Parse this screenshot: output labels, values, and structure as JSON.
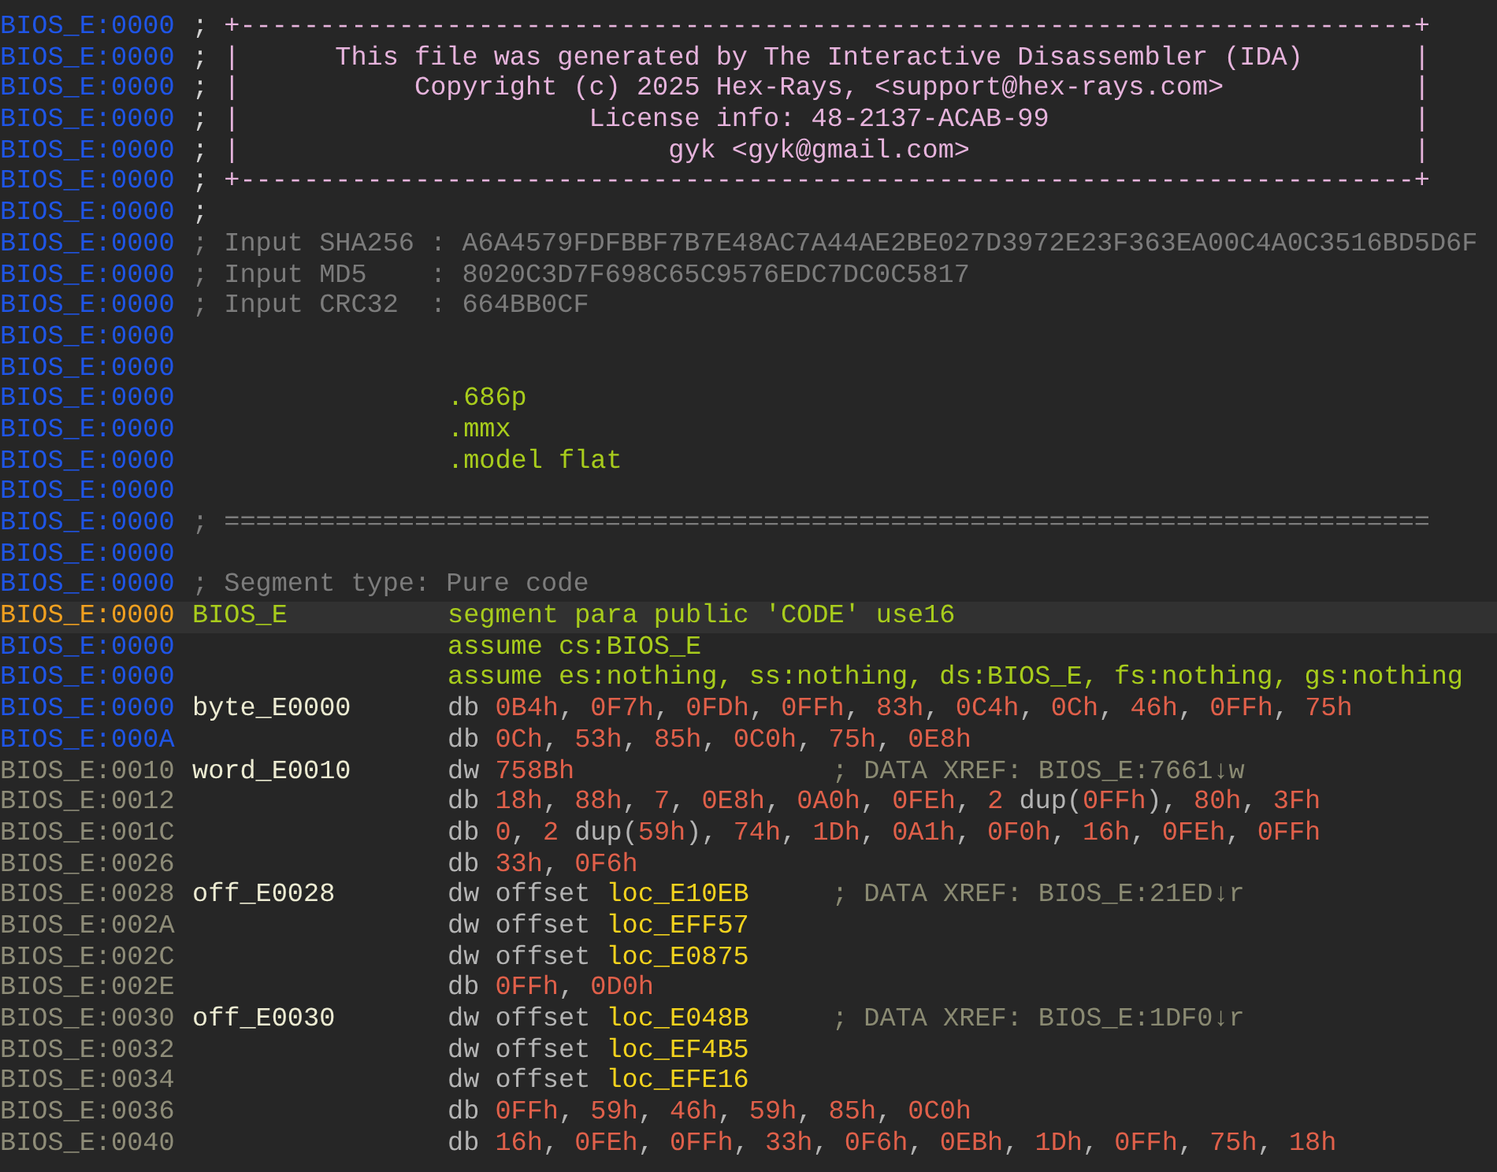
{
  "listing": {
    "lines": [
      {
        "address": "BIOS_E:0000",
        "kind": "code",
        "selected": false,
        "comment": [
          {
            "text": "; ",
            "kind": "punct"
          },
          {
            "text": "+--------------------------------------------------------------------------+",
            "kind": "banner"
          }
        ]
      },
      {
        "address": "BIOS_E:0000",
        "kind": "code",
        "selected": false,
        "comment": [
          {
            "text": "; ",
            "kind": "punct"
          },
          {
            "text": "|      This file was generated by The Interactive Disassembler (IDA)       |",
            "kind": "banner"
          }
        ]
      },
      {
        "address": "BIOS_E:0000",
        "kind": "code",
        "selected": false,
        "comment": [
          {
            "text": "; ",
            "kind": "punct"
          },
          {
            "text": "|           Copyright (c) 2025 Hex-Rays, <support@hex-rays.com>            |",
            "kind": "banner"
          }
        ]
      },
      {
        "address": "BIOS_E:0000",
        "kind": "code",
        "selected": false,
        "comment": [
          {
            "text": "; ",
            "kind": "punct"
          },
          {
            "text": "|                      License info: 48-2137-ACAB-99                       |",
            "kind": "banner"
          }
        ]
      },
      {
        "address": "BIOS_E:0000",
        "kind": "code",
        "selected": false,
        "comment": [
          {
            "text": "; ",
            "kind": "punct"
          },
          {
            "text": "|                           gyk <gyk@gmail.com>                            |",
            "kind": "banner"
          }
        ]
      },
      {
        "address": "BIOS_E:0000",
        "kind": "code",
        "selected": false,
        "comment": [
          {
            "text": "; ",
            "kind": "punct"
          },
          {
            "text": "+--------------------------------------------------------------------------+",
            "kind": "banner"
          }
        ]
      },
      {
        "address": "BIOS_E:0000",
        "kind": "code",
        "selected": false,
        "comment": [
          {
            "text": ";",
            "kind": "punct"
          }
        ]
      },
      {
        "address": "BIOS_E:0000",
        "kind": "code",
        "selected": false,
        "comment": [
          {
            "text": "; Input SHA256 : A6A4579FDFBBF7B7E48AC7A44AE2BE027D3972E23F363EA00C4A0C3516BD5D6F",
            "kind": "note"
          }
        ]
      },
      {
        "address": "BIOS_E:0000",
        "kind": "code",
        "selected": false,
        "comment": [
          {
            "text": "; Input MD5    : 8020C3D7F698C65C9576EDC7DC0C5817",
            "kind": "note"
          }
        ]
      },
      {
        "address": "BIOS_E:0000",
        "kind": "code",
        "selected": false,
        "comment": [
          {
            "text": "; Input CRC32  : 664BB0CF",
            "kind": "note"
          }
        ]
      },
      {
        "address": "BIOS_E:0000",
        "kind": "code",
        "selected": false
      },
      {
        "address": "BIOS_E:0000",
        "kind": "code",
        "selected": false
      },
      {
        "address": "BIOS_E:0000",
        "kind": "code",
        "selected": false,
        "code": [
          {
            "text": ".686p",
            "kind": "directive"
          }
        ]
      },
      {
        "address": "BIOS_E:0000",
        "kind": "code",
        "selected": false,
        "code": [
          {
            "text": ".mmx",
            "kind": "directive"
          }
        ]
      },
      {
        "address": "BIOS_E:0000",
        "kind": "code",
        "selected": false,
        "code": [
          {
            "text": ".model flat",
            "kind": "directive"
          }
        ]
      },
      {
        "address": "BIOS_E:0000",
        "kind": "code",
        "selected": false
      },
      {
        "address": "BIOS_E:0000",
        "kind": "code",
        "selected": false,
        "comment": [
          {
            "text": "; ============================================================================",
            "kind": "note"
          }
        ]
      },
      {
        "address": "BIOS_E:0000",
        "kind": "code",
        "selected": false
      },
      {
        "address": "BIOS_E:0000",
        "kind": "code",
        "selected": false,
        "comment": [
          {
            "text": "; Segment type: Pure code",
            "kind": "note"
          }
        ]
      },
      {
        "address": "BIOS_E:0000",
        "kind": "code",
        "selected": true,
        "label": {
          "text": "BIOS_E",
          "kind": "segment"
        },
        "code": [
          {
            "text": "segment para public 'CODE' use16",
            "kind": "directive"
          }
        ]
      },
      {
        "address": "BIOS_E:0000",
        "kind": "code",
        "selected": false,
        "code": [
          {
            "text": "assume cs:BIOS_E",
            "kind": "directive"
          }
        ]
      },
      {
        "address": "BIOS_E:0000",
        "kind": "code",
        "selected": false,
        "code": [
          {
            "text": "assume es:nothing, ss:nothing, ds:BIOS_E, fs:nothing, gs:nothing",
            "kind": "directive"
          }
        ]
      },
      {
        "address": "BIOS_E:0000",
        "kind": "code",
        "selected": false,
        "label": {
          "text": "byte_E0000",
          "kind": "name"
        },
        "code": [
          {
            "text": "db ",
            "kind": "plain"
          },
          {
            "text": "0B4h",
            "kind": "number"
          },
          {
            "text": ", ",
            "kind": "plain"
          },
          {
            "text": "0F7h",
            "kind": "number"
          },
          {
            "text": ", ",
            "kind": "plain"
          },
          {
            "text": "0FDh",
            "kind": "number"
          },
          {
            "text": ", ",
            "kind": "plain"
          },
          {
            "text": "0FFh",
            "kind": "number"
          },
          {
            "text": ", ",
            "kind": "plain"
          },
          {
            "text": "83h",
            "kind": "number"
          },
          {
            "text": ", ",
            "kind": "plain"
          },
          {
            "text": "0C4h",
            "kind": "number"
          },
          {
            "text": ", ",
            "kind": "plain"
          },
          {
            "text": "0Ch",
            "kind": "number"
          },
          {
            "text": ", ",
            "kind": "plain"
          },
          {
            "text": "46h",
            "kind": "number"
          },
          {
            "text": ", ",
            "kind": "plain"
          },
          {
            "text": "0FFh",
            "kind": "number"
          },
          {
            "text": ", ",
            "kind": "plain"
          },
          {
            "text": "75h",
            "kind": "number"
          }
        ]
      },
      {
        "address": "BIOS_E:000A",
        "kind": "code",
        "selected": false,
        "code": [
          {
            "text": "db ",
            "kind": "plain"
          },
          {
            "text": "0Ch",
            "kind": "number"
          },
          {
            "text": ", ",
            "kind": "plain"
          },
          {
            "text": "53h",
            "kind": "number"
          },
          {
            "text": ", ",
            "kind": "plain"
          },
          {
            "text": "85h",
            "kind": "number"
          },
          {
            "text": ", ",
            "kind": "plain"
          },
          {
            "text": "0C0h",
            "kind": "number"
          },
          {
            "text": ", ",
            "kind": "plain"
          },
          {
            "text": "75h",
            "kind": "number"
          },
          {
            "text": ", ",
            "kind": "plain"
          },
          {
            "text": "0E8h",
            "kind": "number"
          }
        ]
      },
      {
        "address": "BIOS_E:0010",
        "kind": "data",
        "selected": false,
        "label": {
          "text": "word_E0010",
          "kind": "name"
        },
        "code": [
          {
            "text": "dw ",
            "kind": "plain"
          },
          {
            "text": "758Bh",
            "kind": "number"
          }
        ],
        "xref": "; DATA XREF: BIOS_E:7661↓w"
      },
      {
        "address": "BIOS_E:0012",
        "kind": "data",
        "selected": false,
        "code": [
          {
            "text": "db ",
            "kind": "plain"
          },
          {
            "text": "18h",
            "kind": "number"
          },
          {
            "text": ", ",
            "kind": "plain"
          },
          {
            "text": "88h",
            "kind": "number"
          },
          {
            "text": ", ",
            "kind": "plain"
          },
          {
            "text": "7",
            "kind": "number"
          },
          {
            "text": ", ",
            "kind": "plain"
          },
          {
            "text": "0E8h",
            "kind": "number"
          },
          {
            "text": ", ",
            "kind": "plain"
          },
          {
            "text": "0A0h",
            "kind": "number"
          },
          {
            "text": ", ",
            "kind": "plain"
          },
          {
            "text": "0FEh",
            "kind": "number"
          },
          {
            "text": ", ",
            "kind": "plain"
          },
          {
            "text": "2",
            "kind": "number"
          },
          {
            "text": " dup(",
            "kind": "plain"
          },
          {
            "text": "0FFh",
            "kind": "number"
          },
          {
            "text": "), ",
            "kind": "plain"
          },
          {
            "text": "80h",
            "kind": "number"
          },
          {
            "text": ", ",
            "kind": "plain"
          },
          {
            "text": "3Fh",
            "kind": "number"
          }
        ]
      },
      {
        "address": "BIOS_E:001C",
        "kind": "data",
        "selected": false,
        "code": [
          {
            "text": "db ",
            "kind": "plain"
          },
          {
            "text": "0",
            "kind": "number"
          },
          {
            "text": ", ",
            "kind": "plain"
          },
          {
            "text": "2",
            "kind": "number"
          },
          {
            "text": " dup(",
            "kind": "plain"
          },
          {
            "text": "59h",
            "kind": "number"
          },
          {
            "text": "), ",
            "kind": "plain"
          },
          {
            "text": "74h",
            "kind": "number"
          },
          {
            "text": ", ",
            "kind": "plain"
          },
          {
            "text": "1Dh",
            "kind": "number"
          },
          {
            "text": ", ",
            "kind": "plain"
          },
          {
            "text": "0A1h",
            "kind": "number"
          },
          {
            "text": ", ",
            "kind": "plain"
          },
          {
            "text": "0F0h",
            "kind": "number"
          },
          {
            "text": ", ",
            "kind": "plain"
          },
          {
            "text": "16h",
            "kind": "number"
          },
          {
            "text": ", ",
            "kind": "plain"
          },
          {
            "text": "0FEh",
            "kind": "number"
          },
          {
            "text": ", ",
            "kind": "plain"
          },
          {
            "text": "0FFh",
            "kind": "number"
          }
        ]
      },
      {
        "address": "BIOS_E:0026",
        "kind": "data",
        "selected": false,
        "code": [
          {
            "text": "db ",
            "kind": "plain"
          },
          {
            "text": "33h",
            "kind": "number"
          },
          {
            "text": ", ",
            "kind": "plain"
          },
          {
            "text": "0F6h",
            "kind": "number"
          }
        ]
      },
      {
        "address": "BIOS_E:0028",
        "kind": "data",
        "selected": false,
        "label": {
          "text": "off_E0028",
          "kind": "name"
        },
        "code": [
          {
            "text": "dw offset ",
            "kind": "plain"
          },
          {
            "text": "loc_E10EB",
            "kind": "location"
          }
        ],
        "xref": "; DATA XREF: BIOS_E:21ED↓r"
      },
      {
        "address": "BIOS_E:002A",
        "kind": "data",
        "selected": false,
        "code": [
          {
            "text": "dw offset ",
            "kind": "plain"
          },
          {
            "text": "loc_EFF57",
            "kind": "location"
          }
        ]
      },
      {
        "address": "BIOS_E:002C",
        "kind": "data",
        "selected": false,
        "code": [
          {
            "text": "dw offset ",
            "kind": "plain"
          },
          {
            "text": "loc_E0875",
            "kind": "location"
          }
        ]
      },
      {
        "address": "BIOS_E:002E",
        "kind": "data",
        "selected": false,
        "code": [
          {
            "text": "db ",
            "kind": "plain"
          },
          {
            "text": "0FFh",
            "kind": "number"
          },
          {
            "text": ", ",
            "kind": "plain"
          },
          {
            "text": "0D0h",
            "kind": "number"
          }
        ]
      },
      {
        "address": "BIOS_E:0030",
        "kind": "data",
        "selected": false,
        "label": {
          "text": "off_E0030",
          "kind": "name"
        },
        "code": [
          {
            "text": "dw offset ",
            "kind": "plain"
          },
          {
            "text": "loc_E048B",
            "kind": "location"
          }
        ],
        "xref": "; DATA XREF: BIOS_E:1DF0↓r"
      },
      {
        "address": "BIOS_E:0032",
        "kind": "data",
        "selected": false,
        "code": [
          {
            "text": "dw offset ",
            "kind": "plain"
          },
          {
            "text": "loc_EF4B5",
            "kind": "location"
          }
        ]
      },
      {
        "address": "BIOS_E:0034",
        "kind": "data",
        "selected": false,
        "code": [
          {
            "text": "dw offset ",
            "kind": "plain"
          },
          {
            "text": "loc_EFE16",
            "kind": "location"
          }
        ]
      },
      {
        "address": "BIOS_E:0036",
        "kind": "data",
        "selected": false,
        "code": [
          {
            "text": "db ",
            "kind": "plain"
          },
          {
            "text": "0FFh",
            "kind": "number"
          },
          {
            "text": ", ",
            "kind": "plain"
          },
          {
            "text": "59h",
            "kind": "number"
          },
          {
            "text": ", ",
            "kind": "plain"
          },
          {
            "text": "46h",
            "kind": "number"
          },
          {
            "text": ", ",
            "kind": "plain"
          },
          {
            "text": "59h",
            "kind": "number"
          },
          {
            "text": ", ",
            "kind": "plain"
          },
          {
            "text": "85h",
            "kind": "number"
          },
          {
            "text": ", ",
            "kind": "plain"
          },
          {
            "text": "0C0h",
            "kind": "number"
          }
        ]
      },
      {
        "address": "BIOS_E:0040",
        "kind": "data",
        "selected": false,
        "code": [
          {
            "text": "db ",
            "kind": "plain"
          },
          {
            "text": "16h",
            "kind": "number"
          },
          {
            "text": ", ",
            "kind": "plain"
          },
          {
            "text": "0FEh",
            "kind": "number"
          },
          {
            "text": ", ",
            "kind": "plain"
          },
          {
            "text": "0FFh",
            "kind": "number"
          },
          {
            "text": ", ",
            "kind": "plain"
          },
          {
            "text": "33h",
            "kind": "number"
          },
          {
            "text": ", ",
            "kind": "plain"
          },
          {
            "text": "0F6h",
            "kind": "number"
          },
          {
            "text": ", ",
            "kind": "plain"
          },
          {
            "text": "0EBh",
            "kind": "number"
          },
          {
            "text": ", ",
            "kind": "plain"
          },
          {
            "text": "1Dh",
            "kind": "number"
          },
          {
            "text": ", ",
            "kind": "plain"
          },
          {
            "text": "0FFh",
            "kind": "number"
          },
          {
            "text": ", ",
            "kind": "plain"
          },
          {
            "text": "75h",
            "kind": "number"
          },
          {
            "text": ", ",
            "kind": "plain"
          },
          {
            "text": "18h",
            "kind": "number"
          }
        ]
      }
    ]
  }
}
